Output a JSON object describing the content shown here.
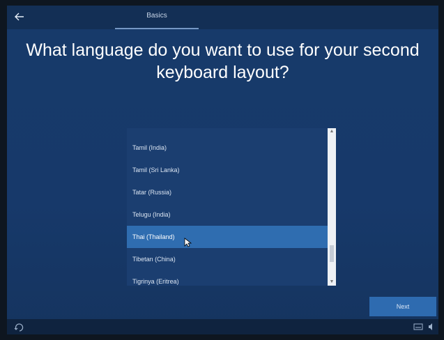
{
  "header": {
    "back_icon": "back-arrow-icon",
    "tab_label": "Basics"
  },
  "title": "What language do you want to use for your second keyboard layout?",
  "languages": [
    {
      "label": "Tamil (India)",
      "selected": false
    },
    {
      "label": "Tamil (Sri Lanka)",
      "selected": false
    },
    {
      "label": "Tatar (Russia)",
      "selected": false
    },
    {
      "label": "Telugu (India)",
      "selected": false
    },
    {
      "label": "Thai (Thailand)",
      "selected": true
    },
    {
      "label": "Tibetan (China)",
      "selected": false
    },
    {
      "label": "Tigrinya (Eritrea)",
      "selected": false
    }
  ],
  "buttons": {
    "next_label": "Next"
  },
  "footer": {
    "accessibility_icon": "accessibility-icon",
    "keyboard_icon": "keyboard-icon",
    "volume_icon": "volume-icon"
  },
  "colors": {
    "background": "#17396a",
    "selected": "#2f6db0",
    "next_button": "#2e6bb0"
  }
}
